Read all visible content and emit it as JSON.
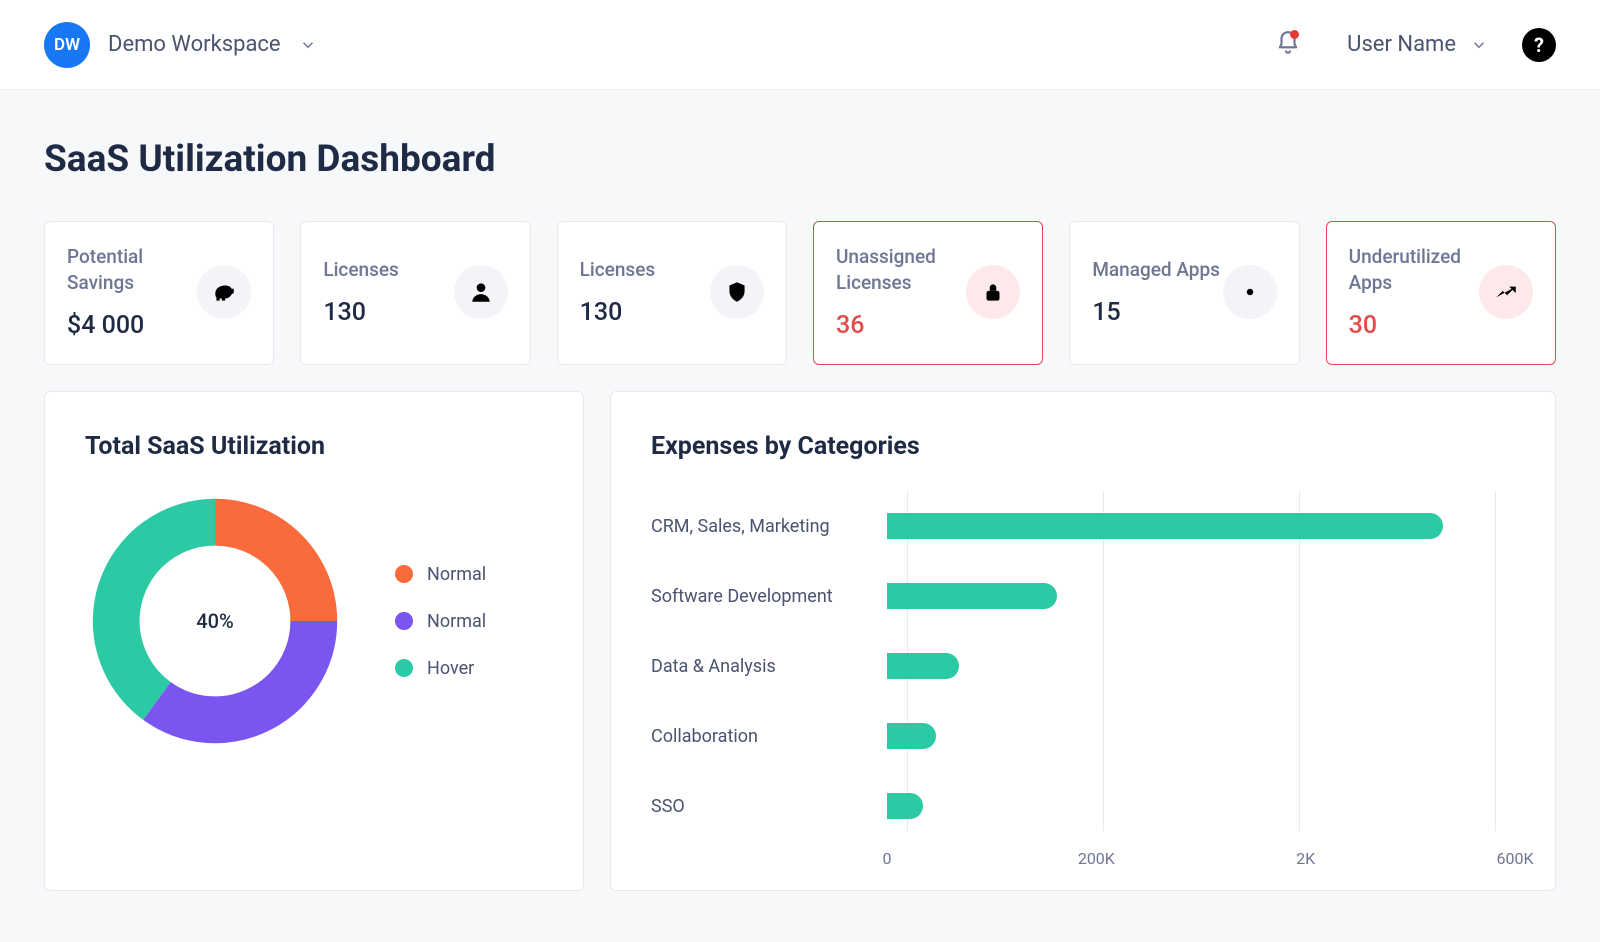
{
  "header": {
    "workspace_initials": "DW",
    "workspace_name": "Demo Workspace",
    "user_name": "User Name",
    "help_symbol": "?"
  },
  "page": {
    "title": "SaaS Utilization Dashboard"
  },
  "colors": {
    "accent_teal": "#2cc9a5",
    "accent_red": "#e44b4b",
    "accent_orange": "#f96a3c",
    "accent_purple": "#7a55ef"
  },
  "kpis": [
    {
      "id": "potential-savings",
      "label": "Potential Savings",
      "value": "$4 000",
      "icon": "piggy-bank-icon",
      "alert": false
    },
    {
      "id": "licenses-users",
      "label": "Licenses",
      "value": "130",
      "icon": "user-icon",
      "alert": false
    },
    {
      "id": "licenses-secured",
      "label": "Licenses",
      "value": "130",
      "icon": "shield-icon",
      "alert": false
    },
    {
      "id": "unassigned-licenses",
      "label": "Unassigned Licenses",
      "value": "36",
      "icon": "lock-icon",
      "alert": true
    },
    {
      "id": "managed-apps",
      "label": "Managed Apps",
      "value": "15",
      "icon": "gear-icon",
      "alert": false
    },
    {
      "id": "underutilized-apps",
      "label": "Underutilized Apps",
      "value": "30",
      "icon": "line-chart-icon",
      "alert": true
    }
  ],
  "donut": {
    "title": "Total SaaS Utilization",
    "center_label": "40%",
    "legend": [
      {
        "label": "Normal",
        "color": "#f96a3c"
      },
      {
        "label": "Normal",
        "color": "#7a55ef"
      },
      {
        "label": "Hover",
        "color": "#2cc9a5"
      }
    ]
  },
  "bar": {
    "title": "Expenses by Categories",
    "axis_labels": [
      "0",
      "200K",
      "2K",
      "600K"
    ]
  },
  "chart_data": [
    {
      "type": "pie",
      "title": "Total SaaS Utilization",
      "series": [
        {
          "name": "Normal",
          "value": 25,
          "color": "#f96a3c"
        },
        {
          "name": "Normal",
          "value": 35,
          "color": "#7a55ef"
        },
        {
          "name": "Hover",
          "value": 40,
          "color": "#2cc9a5"
        }
      ],
      "center_label": "40%"
    },
    {
      "type": "bar",
      "orientation": "horizontal",
      "title": "Expenses by Categories",
      "xlabel": "",
      "ylabel": "",
      "xlim": [
        0,
        700000
      ],
      "categories": [
        "CRM, Sales, Marketing",
        "Software Development",
        "Data & Analysis",
        "Collaboration",
        "SSO"
      ],
      "values": [
        620000,
        190000,
        80000,
        55000,
        40000
      ],
      "ticks_displayed": [
        "0",
        "200K",
        "2K",
        "600K"
      ],
      "color": "#2cc9a5"
    }
  ]
}
